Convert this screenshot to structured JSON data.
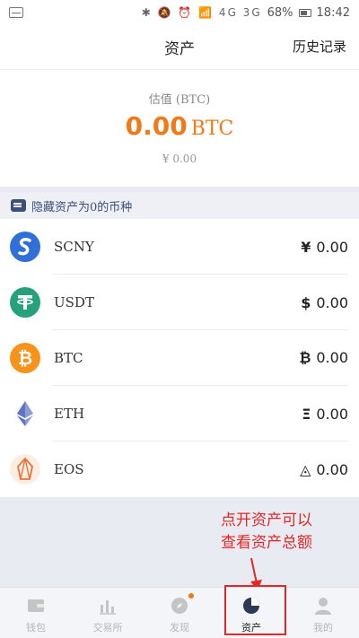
{
  "status_bar": {
    "battery": "68%",
    "time": "18:42",
    "icons": "✱ 🔕 ⏰ 📶 4G 3G"
  },
  "header": {
    "title": "资产",
    "history": "历史记录"
  },
  "estimate": {
    "label": "估值 (BTC)",
    "value": "0.00",
    "unit": "BTC",
    "cny": "¥ 0.00"
  },
  "hide_bar": {
    "label": "隐藏资产为0的币种"
  },
  "assets": [
    {
      "name": "SCNY",
      "symbol": "¥",
      "balance": "0.00",
      "icon": "scny-icon",
      "color": "#2f6fd6"
    },
    {
      "name": "USDT",
      "symbol": "$",
      "balance": "0.00",
      "icon": "tether-icon",
      "color": "#26a17b"
    },
    {
      "name": "BTC",
      "symbol": "₿",
      "balance": "0.00",
      "icon": "bitcoin-icon",
      "color": "#f7931a"
    },
    {
      "name": "ETH",
      "symbol": "Ξ",
      "balance": "0.00",
      "icon": "ethereum-icon",
      "color": "#627eea"
    },
    {
      "name": "EOS",
      "symbol": "◬",
      "balance": "0.00",
      "icon": "eos-icon",
      "color": "#e8733a"
    }
  ],
  "annotation": {
    "line1": "点开资产可以",
    "line2": "查看资产总额"
  },
  "nav": [
    {
      "label": "钱包",
      "icon": "wallet-icon"
    },
    {
      "label": "交易所",
      "icon": "chart-icon"
    },
    {
      "label": "发现",
      "icon": "compass-icon"
    },
    {
      "label": "资产",
      "icon": "pie-chart-icon"
    },
    {
      "label": "我的",
      "icon": "user-icon"
    }
  ],
  "colors": {
    "accent": "#f07918",
    "annotation": "#e02828",
    "hide_bar": "#3b4f7a"
  }
}
